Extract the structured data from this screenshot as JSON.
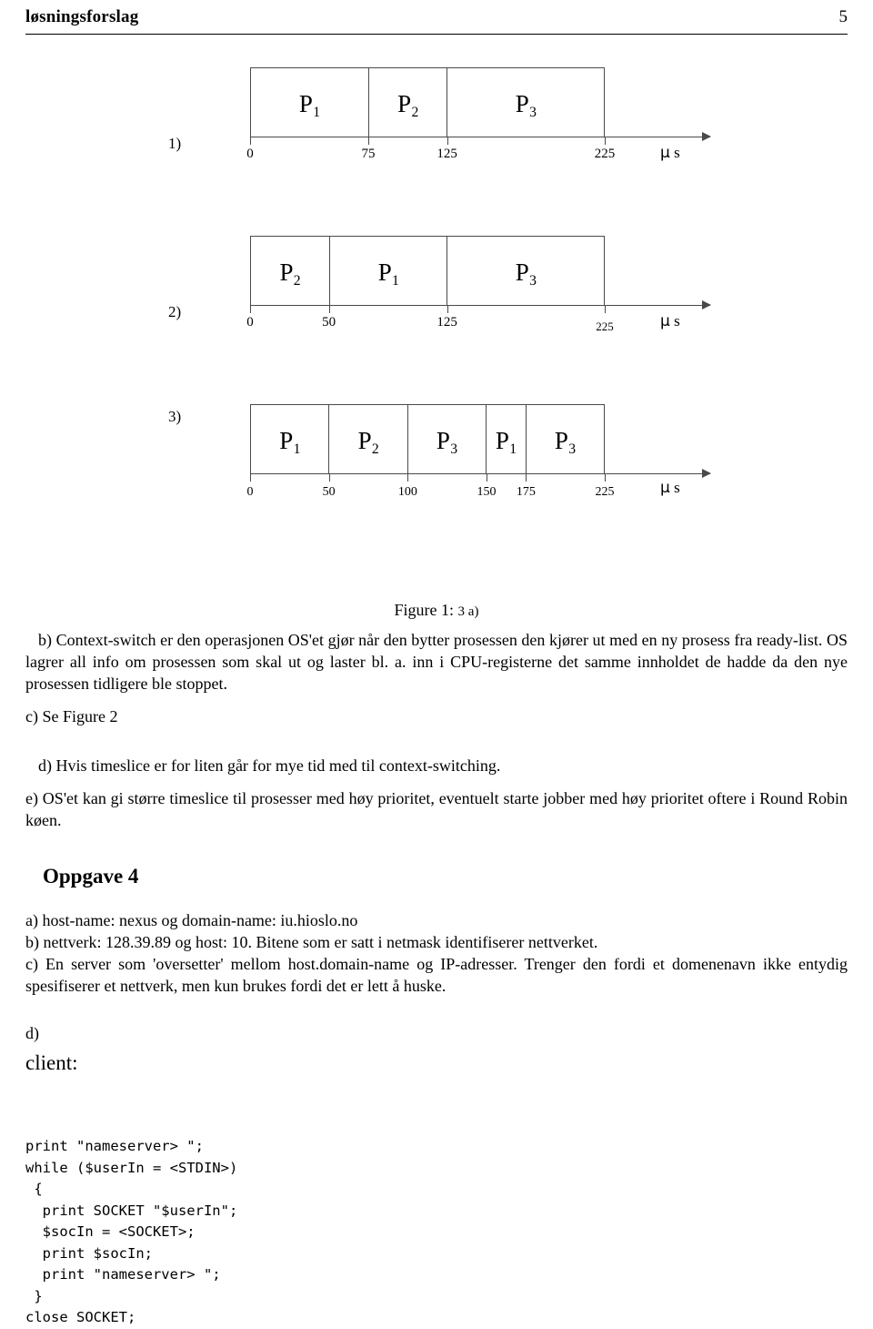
{
  "header": {
    "title": "løsningsforslag",
    "page_number": "5"
  },
  "figure": {
    "caption_label": "Figure 1:",
    "caption_text": "3 a)",
    "unit_label": "μ s",
    "charts": [
      {
        "name": "1)",
        "ticks": [
          0,
          75,
          125,
          225
        ],
        "tick_labels": [
          "0",
          "75",
          "125",
          "225"
        ],
        "segments": [
          {
            "label": "P",
            "sub": "1",
            "start": 0,
            "end": 75
          },
          {
            "label": "P",
            "sub": "2",
            "start": 75,
            "end": 125
          },
          {
            "label": "P",
            "sub": "3",
            "start": 125,
            "end": 225
          }
        ]
      },
      {
        "name": "2)",
        "ticks": [
          0,
          50,
          125,
          225
        ],
        "tick_labels": [
          "0",
          "50",
          "125",
          "225"
        ],
        "segments": [
          {
            "label": "P",
            "sub": "2",
            "start": 0,
            "end": 50
          },
          {
            "label": "P",
            "sub": "1",
            "start": 50,
            "end": 125
          },
          {
            "label": "P",
            "sub": "3",
            "start": 125,
            "end": 225
          }
        ]
      },
      {
        "name": "3)",
        "ticks": [
          0,
          50,
          100,
          150,
          175,
          225
        ],
        "tick_labels": [
          "0",
          "50",
          "100",
          "150",
          "175",
          "225"
        ],
        "segments": [
          {
            "label": "P",
            "sub": "1",
            "start": 0,
            "end": 50
          },
          {
            "label": "P",
            "sub": "2",
            "start": 50,
            "end": 100
          },
          {
            "label": "P",
            "sub": "3",
            "start": 100,
            "end": 150
          },
          {
            "label": "P",
            "sub": "1",
            "start": 150,
            "end": 175
          },
          {
            "label": "P",
            "sub": "3",
            "start": 175,
            "end": 225
          }
        ]
      }
    ]
  },
  "chart_data": {
    "type": "bar",
    "title": "Figure 1: 3 a)",
    "xlabel": "μ s",
    "ylabel": "",
    "xlim": [
      0,
      225
    ],
    "grid": false,
    "legend": "none",
    "charts": [
      {
        "name": "1)",
        "categories": [
          "P1",
          "P2",
          "P3"
        ],
        "starts": [
          0,
          75,
          125
        ],
        "ends": [
          75,
          125,
          225
        ],
        "values": [
          75,
          50,
          100
        ],
        "ticks": [
          0,
          75,
          125,
          225
        ]
      },
      {
        "name": "2)",
        "categories": [
          "P2",
          "P1",
          "P3"
        ],
        "starts": [
          0,
          50,
          125
        ],
        "ends": [
          50,
          125,
          225
        ],
        "values": [
          50,
          75,
          100
        ],
        "ticks": [
          0,
          50,
          125,
          225
        ]
      },
      {
        "name": "3)",
        "categories": [
          "P1",
          "P2",
          "P3",
          "P1",
          "P3"
        ],
        "starts": [
          0,
          50,
          100,
          150,
          175
        ],
        "ends": [
          50,
          100,
          150,
          175,
          225
        ],
        "values": [
          50,
          50,
          50,
          25,
          50
        ],
        "ticks": [
          0,
          50,
          100,
          150,
          175,
          225
        ]
      }
    ]
  },
  "body": {
    "b_paragraph": "b) Context-switch er den operasjonen OS'et gjør når den bytter prosessen den kjører ut med en ny prosess fra ready-list. OS lagrer all info om prosessen som skal ut og laster bl. a. inn i CPU-registerne det samme innholdet de hadde da den nye prosessen tidligere ble stoppet.",
    "c_paragraph": "c) Se Figure 2",
    "d_paragraph": "d) Hvis timeslice er for liten går for mye tid med til context-switching.",
    "e_paragraph": "e) OS'et kan gi større timeslice til prosesser med høy prioritet, eventuelt starte jobber med høy prioritet oftere i Round Robin køen."
  },
  "oppgave4": {
    "heading": "Oppgave 4",
    "a_line": "a) host-name: nexus og domain-name: iu.hioslo.no",
    "b_line": "b) nettverk: 128.39.89 og host: 10. Bitene som er satt i netmask identifiserer nettverket.",
    "c_line": "c) En server som 'oversetter' mellom host.domain-name og IP-adresser. Trenger den fordi et domenenavn ikke entydig spesifiserer et nettverk, men kun brukes fordi det er lett å huske.",
    "d_line": "d)",
    "client_label": "client:",
    "code_lines": [
      "print \"nameserver> \";",
      "while ($userIn = <STDIN>)",
      " {",
      "  print SOCKET \"$userIn\";",
      "  $socIn = <SOCKET>;",
      "  print $socIn;",
      "  print \"nameserver> \";",
      " }",
      "close SOCKET;"
    ]
  }
}
